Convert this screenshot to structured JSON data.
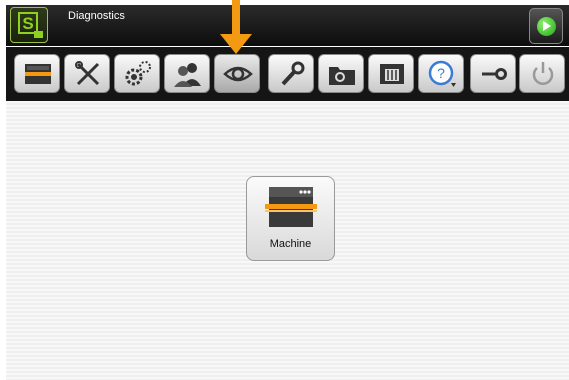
{
  "window": {
    "title": "Diagnostics"
  },
  "colors": {
    "accent": "#f39a12",
    "logo_green": "#8ed11f",
    "next_green": "#23a617"
  },
  "toolbar": {
    "items": [
      {
        "name": "production",
        "icon": "production-icon"
      },
      {
        "name": "tools",
        "icon": "tools-icon"
      },
      {
        "name": "settings",
        "icon": "gears-icon"
      },
      {
        "name": "users",
        "icon": "users-icon"
      },
      {
        "name": "diagnostics",
        "icon": "eye-icon",
        "active": true
      },
      {
        "name": "service",
        "icon": "wrench-icon"
      },
      {
        "name": "folder",
        "icon": "folder-icon"
      },
      {
        "name": "calibration",
        "icon": "sliders-icon"
      },
      {
        "name": "help",
        "icon": "help-icon"
      },
      {
        "name": "key",
        "icon": "key-icon"
      },
      {
        "name": "power",
        "icon": "power-icon"
      }
    ]
  },
  "main": {
    "tiles": [
      {
        "label": "Machine",
        "icon": "machine-icon"
      }
    ]
  }
}
